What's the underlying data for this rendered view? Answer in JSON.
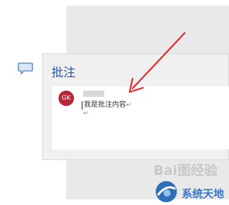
{
  "comment_pane": {
    "title": "批注",
    "comment": {
      "avatar_initials": "GK",
      "text": "我是批注内容",
      "paragraph_mark": "↵"
    }
  },
  "icons": {
    "comment_icon": "speech-bubble",
    "annotation": "red-arrow"
  },
  "watermark": {
    "baidu": "Bai图经验",
    "site": "系统天地"
  },
  "colors": {
    "title": "#2b579a",
    "avatar": "#b5283a",
    "arrow": "#e8262b",
    "site_text": "#3a78c9"
  }
}
